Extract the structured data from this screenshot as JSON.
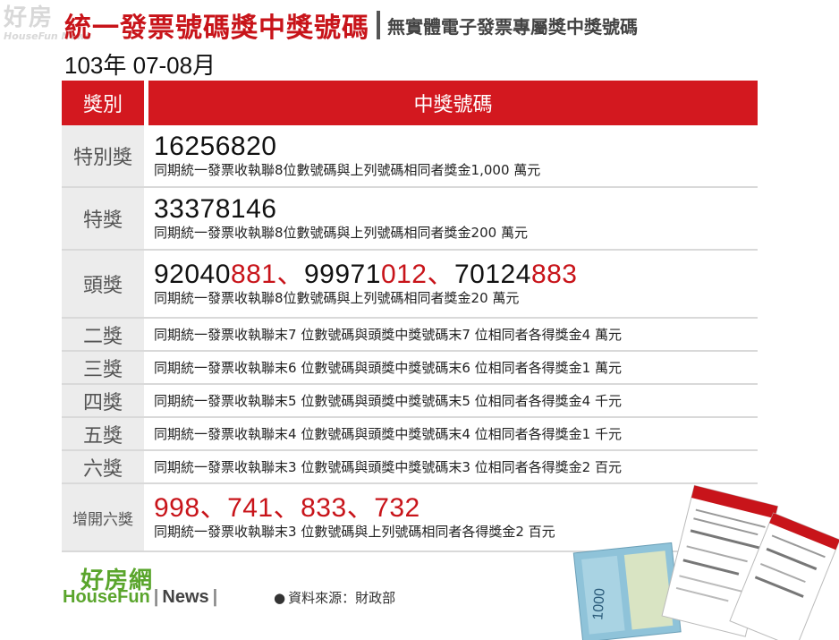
{
  "watermark": {
    "line1": "好房",
    "line2": "HouseFun News"
  },
  "title": {
    "main": "統一發票號碼獎中獎號碼",
    "sub": "無實體電子發票專屬獎中獎號碼"
  },
  "period": "103年 07-08月",
  "table": {
    "header": {
      "category": "獎別",
      "numbers": "中獎號碼"
    },
    "special": {
      "label": "特別獎",
      "number": "16256820",
      "desc": "同期統一發票收執聯8位數號碼與上列號碼相同者獎金1,000 萬元"
    },
    "grand": {
      "label": "特獎",
      "number": "33378146",
      "desc": "同期統一發票收執聯8位數號碼與上列號碼相同者獎金200 萬元"
    },
    "first": {
      "label": "頭獎",
      "numbers": [
        {
          "prefix": "92040",
          "suffix": "881"
        },
        {
          "prefix": "99971",
          "suffix": "012"
        },
        {
          "prefix": "70124",
          "suffix": "883"
        }
      ],
      "separator": "、",
      "desc": "同期統一發票收執聯8位數號碼與上列號碼相同者獎金20 萬元"
    },
    "lower": [
      {
        "label": "二獎",
        "desc": "同期統一發票收執聯末7 位數號碼與頭獎中獎號碼末7 位相同者各得獎金4 萬元"
      },
      {
        "label": "三獎",
        "desc": "同期統一發票收執聯末6 位數號碼與頭獎中獎號碼末6 位相同者各得獎金1 萬元"
      },
      {
        "label": "四獎",
        "desc": "同期統一發票收執聯末5 位數號碼與頭獎中獎號碼末5 位相同者各得獎金4 千元"
      },
      {
        "label": "五獎",
        "desc": "同期統一發票收執聯末4 位數號碼與頭獎中獎號碼末4 位相同者各得獎金1 千元"
      },
      {
        "label": "六獎",
        "desc": "同期統一發票收執聯末3 位數號碼與頭獎中獎號碼末3 位相同者各得獎金2 百元"
      }
    ],
    "extra_sixth": {
      "label": "增開六獎",
      "numbers": [
        "998",
        "741",
        "833",
        "732"
      ],
      "separator": "、",
      "desc": "同期統一發票收執聯末3 位數號碼與上列號碼相同者各得獎金2 百元"
    }
  },
  "footer": {
    "logo_cn": "好房網",
    "logo_en_1": "HouseFun",
    "logo_en_2": "News",
    "source": "資料來源：財政部"
  },
  "colors": {
    "accent": "#c8141a",
    "header_bg": "#d3181f",
    "label_bg": "#ececec",
    "logo_green": "#5aa52c"
  }
}
